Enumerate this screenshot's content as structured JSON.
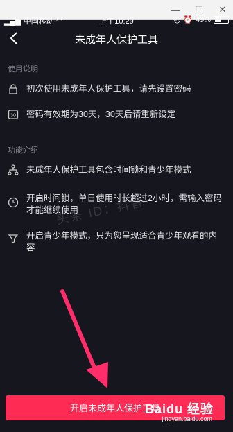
{
  "status": {
    "carrier": "中国移动",
    "time": "上午10:29",
    "battery": "49%",
    "battery_level": 0.49
  },
  "nav": {
    "title": "未成年人保护工具"
  },
  "usage": {
    "heading": "使用说明",
    "items": [
      {
        "icon": "lock-icon",
        "text": "初次使用未成年人保护工具，请先设置密码"
      },
      {
        "icon": "calendar-30-icon",
        "text": "密码有效期为30天，30天后请重新设定"
      }
    ]
  },
  "features": {
    "heading": "功能介绍",
    "items": [
      {
        "icon": "hierarchy-icon",
        "text": "未成年人保护工具包含时间锁和青少年模式"
      },
      {
        "icon": "clock-icon",
        "text": "开启时间锁，单日使用时长超过2小时，需输入密码才能继续使用"
      },
      {
        "icon": "filter-icon",
        "text": "开启青少年模式，只为您呈现适合青少年观看的内容"
      }
    ]
  },
  "watermark": "头条 ID：抖音",
  "button": {
    "label": "开启未成年人保护工具"
  },
  "brand": {
    "name": "Baidu 经验",
    "url": "jingyan.baidu.com"
  },
  "colors": {
    "background": "#16161f",
    "accent": "#fe2c55",
    "arrow": "#ff2d6a"
  }
}
